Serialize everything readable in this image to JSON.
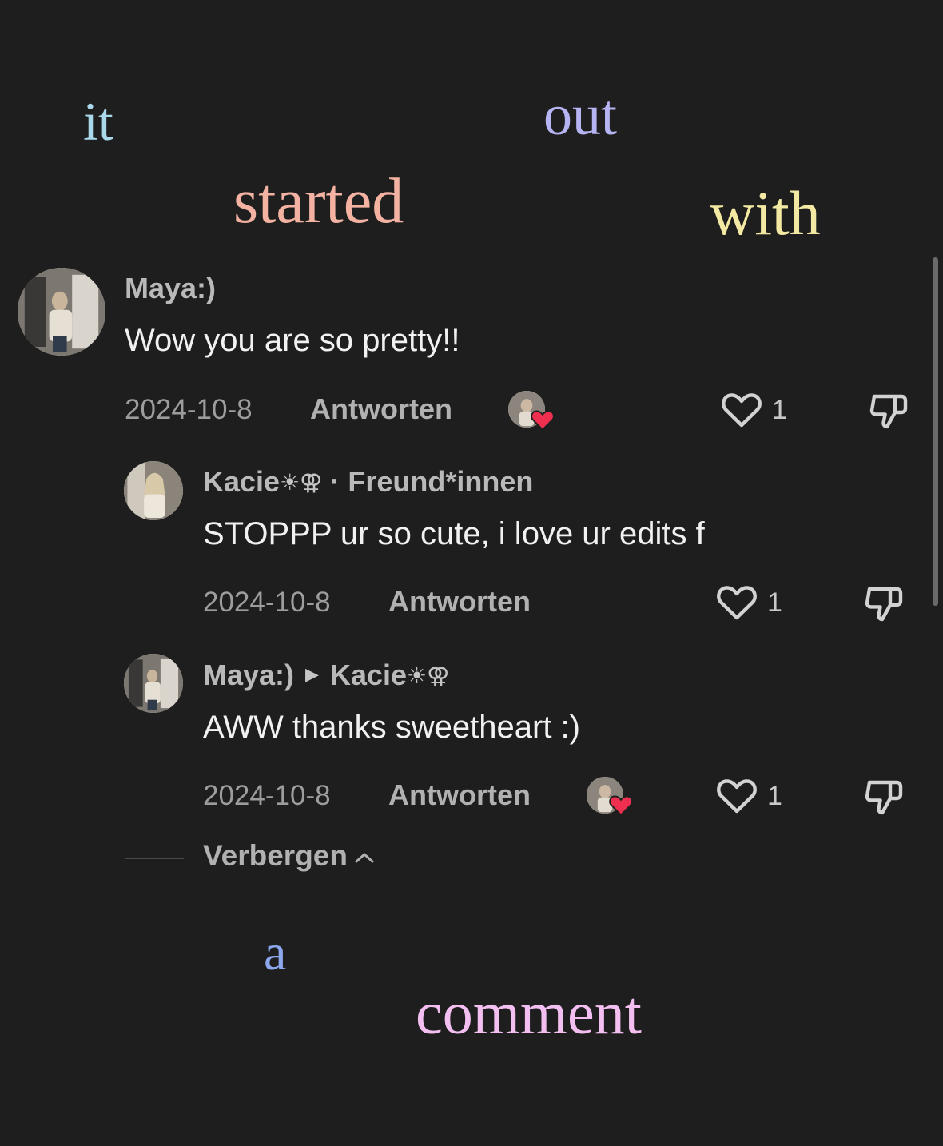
{
  "overlay_words": {
    "it": "it",
    "out": "out",
    "started": "started",
    "with": "with",
    "a": "a",
    "comment": "comment"
  },
  "comments": {
    "main": {
      "username": "Maya:)",
      "text": "Wow you are so pretty!!",
      "date": "2024-10-8",
      "reply_label": "Antworten",
      "likes": "1",
      "creator_liked": true
    },
    "reply1": {
      "username": "Kacie",
      "username_symbols": "☀⚢",
      "separator": "·",
      "relation": "Freund*innen",
      "text": "STOPPP ur so cute, i love ur edits f",
      "date": "2024-10-8",
      "reply_label": "Antworten",
      "likes": "1",
      "creator_liked": false
    },
    "reply2": {
      "username": "Maya:)",
      "reply_to": "Kacie",
      "reply_to_symbols": "☀⚢",
      "text": "AWW thanks sweetheart :)",
      "date": "2024-10-8",
      "reply_label": "Antworten",
      "likes": "1",
      "creator_liked": true
    }
  },
  "hide_replies_label": "Verbergen",
  "icons": {
    "like": "heart-outline-icon",
    "dislike": "thumbs-down-icon",
    "creator_like": "heart-badge-icon",
    "hide": "chevron-up-icon",
    "reply_arrow": "triangle-right-icon"
  },
  "colors": {
    "background": "#1e1e1e",
    "creator_heart": "#ee2f4f"
  }
}
